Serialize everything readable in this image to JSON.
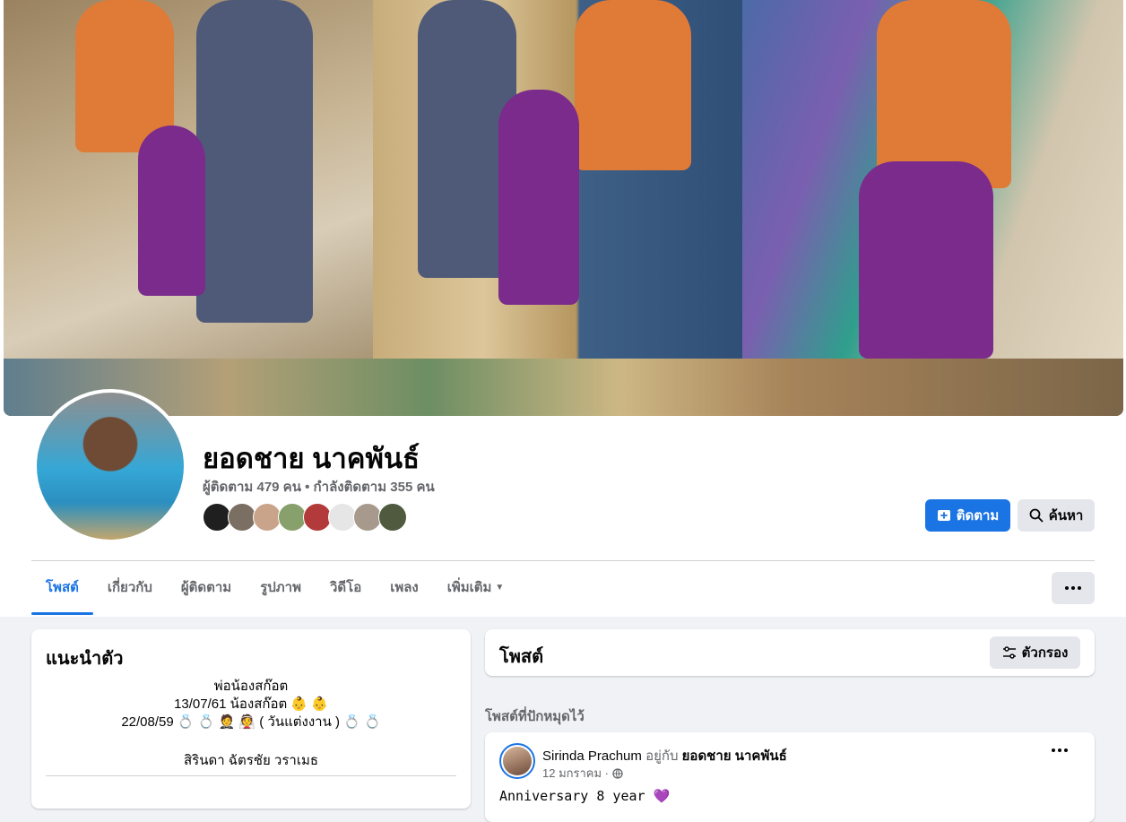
{
  "profile": {
    "name": "ยอดชาย นาคพันธ์",
    "stats": "ผู้ติดตาม 479 คน • กำลังติดตาม 355 คน"
  },
  "actions": {
    "follow_label": "ติดตาม",
    "search_label": "ค้นหา"
  },
  "tabs": [
    {
      "label": "โพสต์",
      "active": true
    },
    {
      "label": "เกี่ยวกับ"
    },
    {
      "label": "ผู้ติดตาม"
    },
    {
      "label": "รูปภาพ"
    },
    {
      "label": "วิดีโอ"
    },
    {
      "label": "เพลง"
    },
    {
      "label": "เพิ่มเติม"
    }
  ],
  "intro": {
    "title": "แนะนำตัว",
    "bio_lines": [
      "พ่อน้องสก๊อต",
      "13/07/61 น้องสก๊อต 👶 👶",
      "22/08/59 💍 💍 🤵 👰 ( วันแต่งงาน ) 💍 💍"
    ],
    "bio_sub": "สิรินดา ฉัตรชัย วราเมธ"
  },
  "posts": {
    "title": "โพสต์",
    "filter_label": "ตัวกรอง",
    "pinned_label": "โพสต์ที่ปักหมุดไว้",
    "pinned": {
      "author": "Sirinda Prachum",
      "with_text": "อยู่กับ",
      "target": "ยอดชาย นาคพันธ์",
      "date": "12 มกราคม ·",
      "text": "Anniversary 8 year 💜"
    }
  },
  "colors": {
    "primary": "#1b74e4",
    "secondary_bg": "#e4e6eb",
    "page_bg": "#f0f2f5"
  }
}
